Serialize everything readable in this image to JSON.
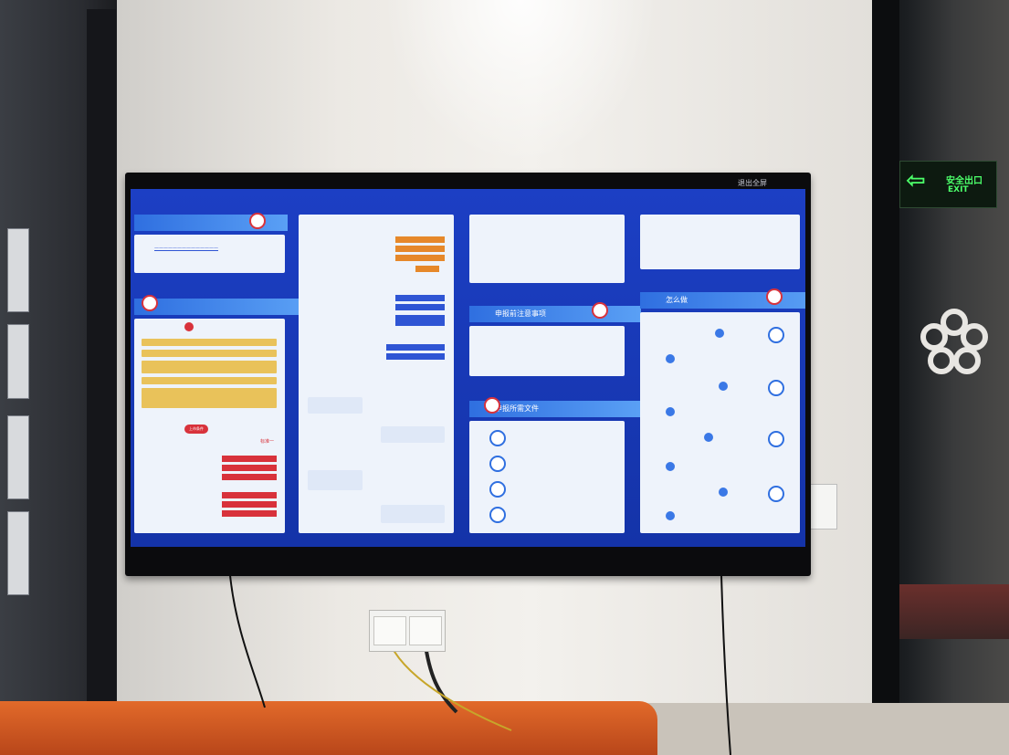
{
  "sign": {
    "cn": "安全出口",
    "en": "EXIT"
  },
  "tv": {
    "exit_label": "退出全屏"
  },
  "screen": {
    "p1_title": "上市条件",
    "p2_ranking_label": "标准一",
    "p4_title": "怎么做",
    "p3_title": "申报前注意事项",
    "p3b_title": "申报所需文件"
  },
  "colors": {
    "screen_blue": "#1c3fc4",
    "panel_bg": "#eef3fb",
    "tag_red": "#d8323b",
    "tag_blue": "#2f55d4"
  }
}
